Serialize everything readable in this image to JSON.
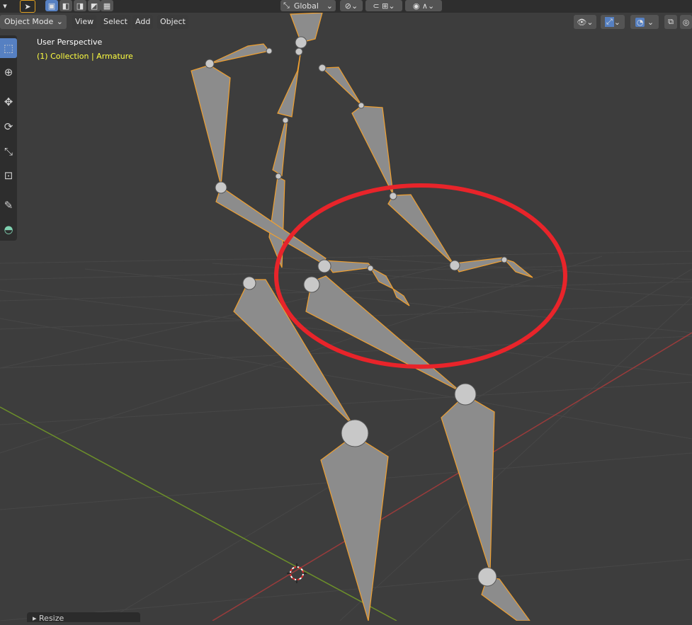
{
  "header": {
    "mode_label": "Object Mode",
    "menu": [
      "View",
      "Select",
      "Add",
      "Object"
    ],
    "orientation_label": "Global"
  },
  "viewport": {
    "perspective_label": "User Perspective",
    "collection_label": "(1) Collection | Armature"
  },
  "panel": {
    "resize_label": "Resize"
  },
  "colors": {
    "background": "#3d3d3d",
    "grid": "#4a4a4a",
    "x_axis": "#9a3b3b",
    "y_axis": "#6c8f2a",
    "bone_fill": "#8c8c8c",
    "bone_outline": "#f0a030",
    "annotation": "#e8242a",
    "selected_text": "#ffff40",
    "active_tool": "#5680c2"
  },
  "icons": [
    "select-icon",
    "cursor-icon",
    "move-icon",
    "rotate-icon",
    "scale-icon",
    "transform-icon",
    "annotate-icon",
    "measure-icon"
  ]
}
